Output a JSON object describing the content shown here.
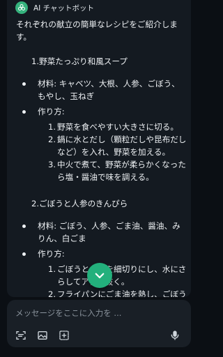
{
  "bot": {
    "name": "AI チャットボット"
  },
  "message": {
    "intro": "それぞれの献立の簡単なレシピをご紹介します。",
    "sections": [
      {
        "title": "1.野菜たっぷり和風スープ",
        "ingredients": "材料: キャベツ、大根、人参、ごぼう、もやし、玉ねぎ",
        "method_label": "作り方:",
        "steps": [
          {
            "num": "1.",
            "text": "野菜を食べやすい大きさに切る。"
          },
          {
            "num": "2.",
            "text": "鍋に水とだし（顆粒だしや昆布だしなど）を入れ、野菜を加える。"
          },
          {
            "num": "3.",
            "text": "中火で煮て、野菜が柔らかくなったら塩・醤油で味を調える。"
          }
        ]
      },
      {
        "title": "2.ごぼうと人参のきんぴら",
        "ingredients": "材料: ごぼう、人参、ごま油、醤油、みりん、白ごま",
        "method_label": "作り方:",
        "steps": [
          {
            "num": "1.",
            "text": "ごぼうと人参を細切りにし、水にさらしてアクを抜く。"
          },
          {
            "num": "2.",
            "text": "フライパンにごま油を熱し、ごぼうと人参を炒める。"
          }
        ]
      }
    ]
  },
  "composer": {
    "placeholder": "メッセージをここに入力を ..."
  },
  "icons": {
    "bot_avatar": "openai-logo-icon",
    "scroll": "chevron-down-icon",
    "scan": "scan-text-icon",
    "image": "image-icon",
    "add": "add-square-icon",
    "mic": "microphone-icon"
  },
  "colors": {
    "accent": "#23b07c",
    "background": "#0b0f14",
    "bubble": "#141a21"
  }
}
